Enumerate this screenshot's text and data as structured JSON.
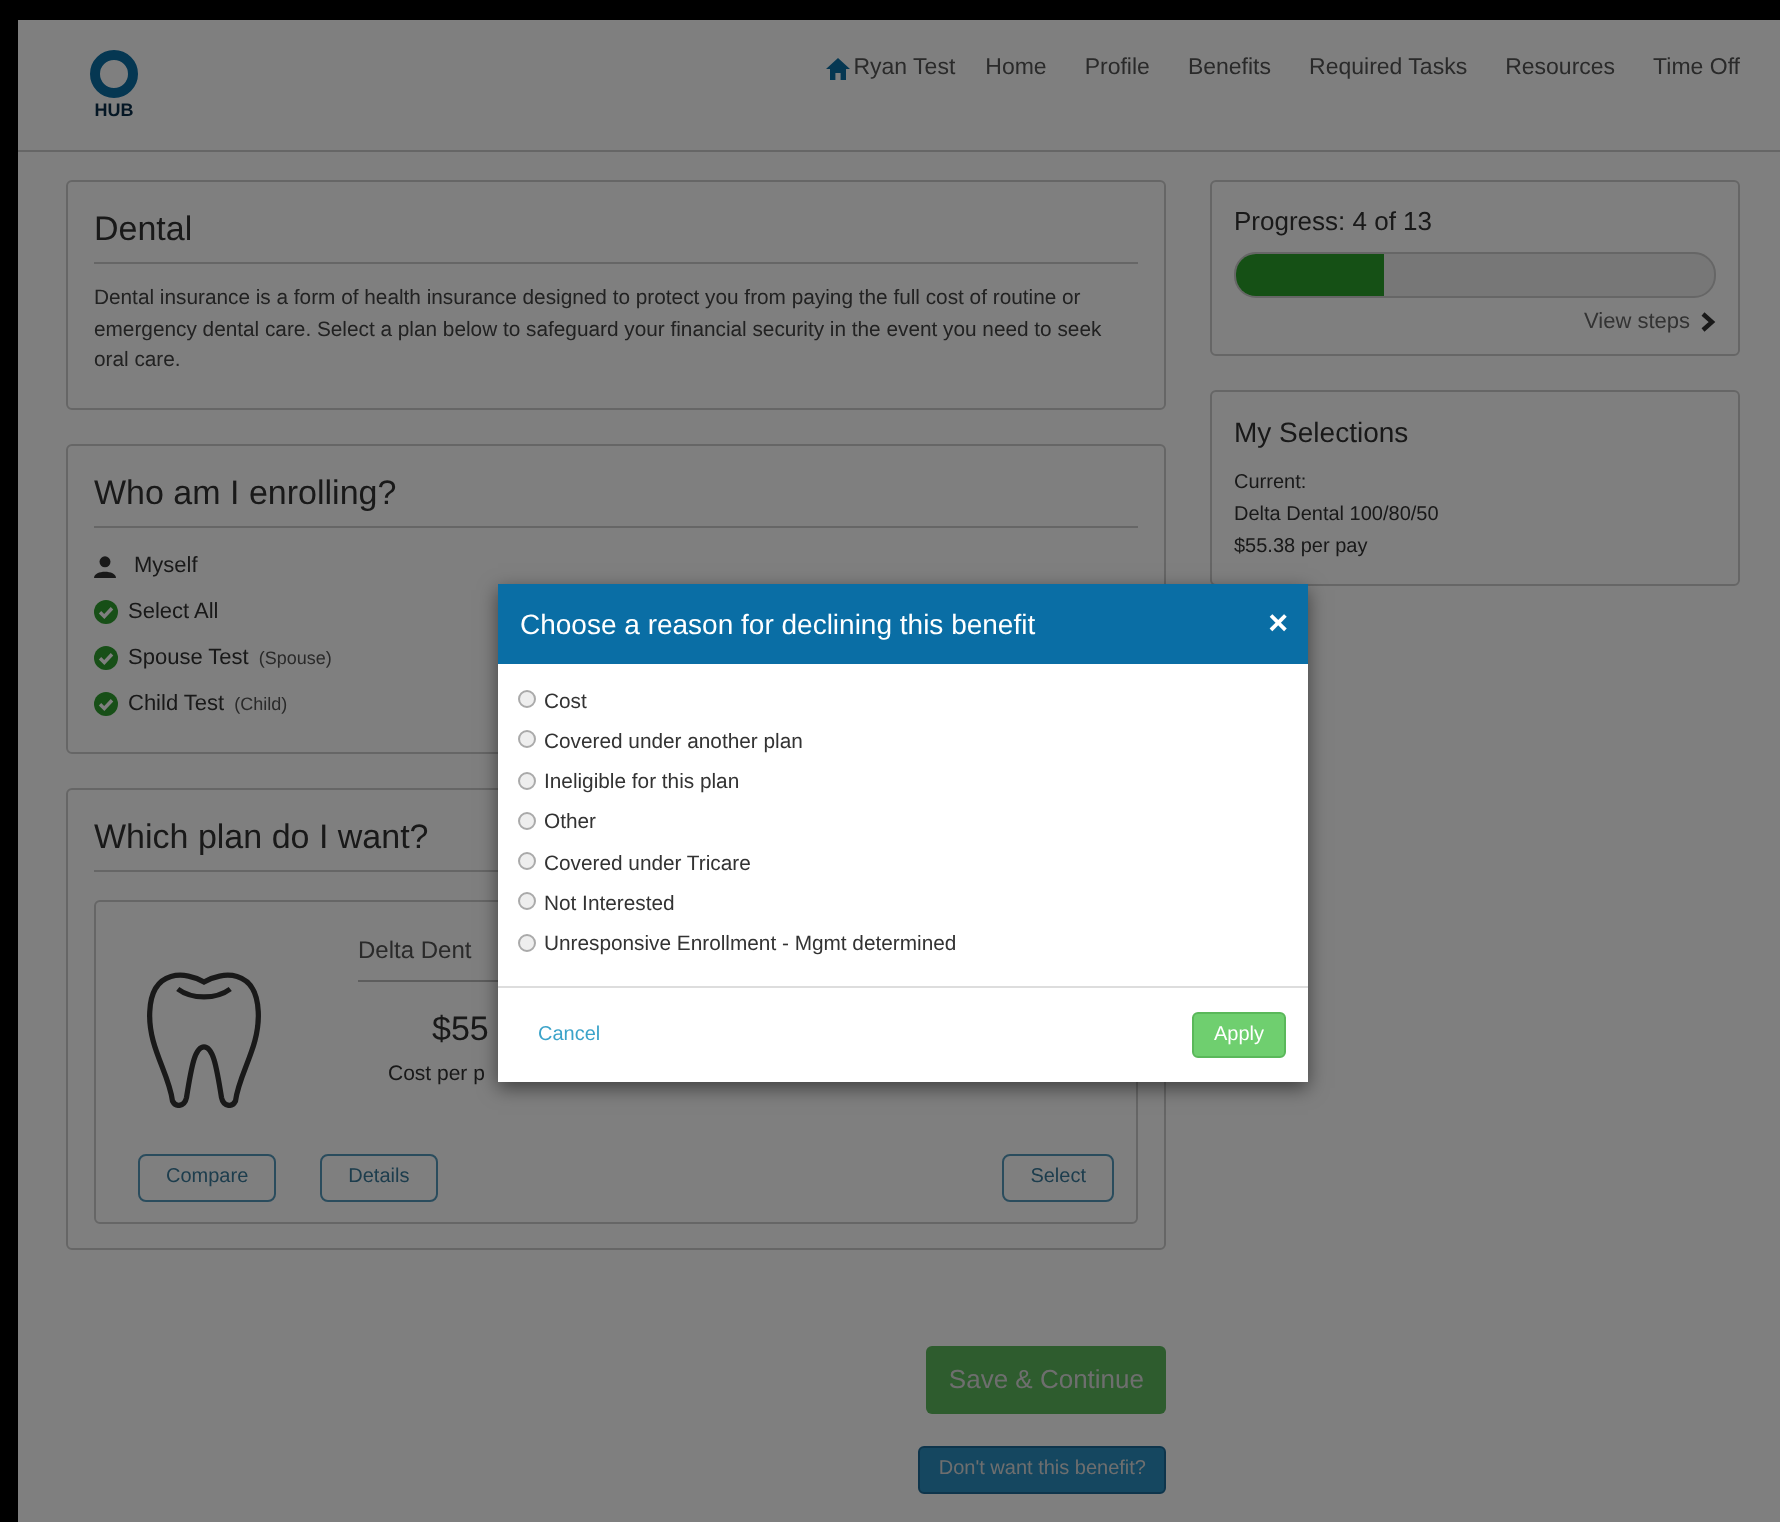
{
  "header": {
    "logo_text": "HUB",
    "user": "Ryan Test",
    "nav": [
      "Home",
      "Profile",
      "Benefits",
      "Required Tasks",
      "Resources",
      "Time Off"
    ]
  },
  "dental": {
    "title": "Dental",
    "description": "Dental insurance is a form of health insurance designed to protect you from paying the full cost of routine or emergency dental care. Select a plan below to safeguard your financial security in the event you need to seek oral care."
  },
  "enrolling": {
    "title": "Who am I enrolling?",
    "members": [
      {
        "kind": "self",
        "name": "Myself"
      },
      {
        "kind": "member",
        "name": "Select All",
        "checked": true
      },
      {
        "kind": "member",
        "name": "Spouse Test",
        "relation": "(Spouse)",
        "checked": true
      },
      {
        "kind": "member",
        "name": "Child Test",
        "relation": "(Child)",
        "checked": true
      }
    ]
  },
  "plan": {
    "title": "Which plan do I want?",
    "plan_name": "Delta Dent",
    "price": "$55",
    "price_caption": "Cost per p",
    "buttons": [
      "Compare",
      "Details",
      "Select"
    ]
  },
  "progress": {
    "label": "Progress: 4 of 13",
    "level": 0.31,
    "link": "View steps"
  },
  "selections": {
    "title": "My Selections",
    "current_label": "Current:",
    "plan": "Delta Dental 100/80/50",
    "price": "$55.38 per pay"
  },
  "actions": {
    "save": "Save & Continue",
    "decline": "Don't want this benefit?"
  },
  "modal": {
    "title": "Choose a reason for declining this benefit",
    "close": "×",
    "options": [
      {
        "label": "Cost",
        "selected": false
      },
      {
        "label": "Covered under another plan",
        "selected": false
      },
      {
        "label": "Ineligible for this plan",
        "selected": false
      },
      {
        "label": "Other",
        "selected": false
      },
      {
        "label": "Covered under Tricare",
        "selected": false
      },
      {
        "label": "Not Interested",
        "selected": false
      },
      {
        "label": "Unresponsive Enrollment - Mgmt determined",
        "selected": false
      }
    ],
    "cancel": "Cancel",
    "apply": "Apply"
  }
}
